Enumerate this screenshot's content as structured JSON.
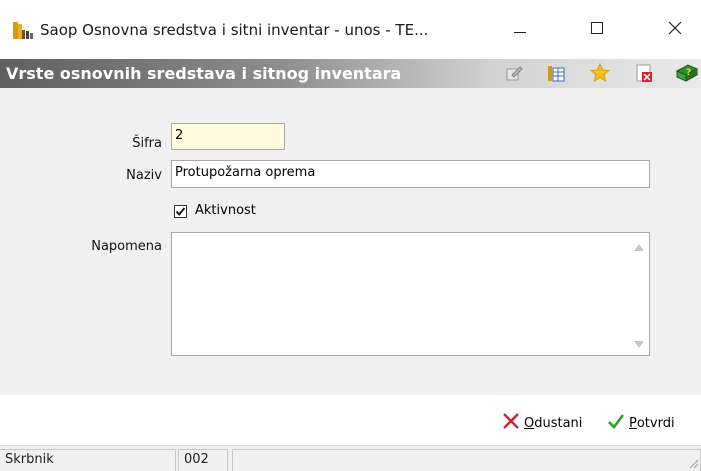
{
  "window": {
    "title": "Saop Osnovna sredstva i sitni inventar - unos - TE...",
    "app_icon": "books-icon",
    "controls": {
      "minimize": "minimize-icon",
      "maximize": "maximize-icon",
      "close": "close-icon"
    }
  },
  "form_header": {
    "title": "Vrste osnovnih sredstava i sitnog inventara",
    "icons": [
      "edit-icon",
      "grid-icon",
      "star-icon",
      "delete-icon",
      "help-book-icon"
    ]
  },
  "form": {
    "sifra": {
      "label": "Šifra",
      "value": "2"
    },
    "naziv": {
      "label": "Naziv",
      "value": "Protupožarna oprema"
    },
    "aktivnost": {
      "label": "Aktivnost",
      "checked": true
    },
    "napomena": {
      "label": "Napomena",
      "value": ""
    }
  },
  "actions": {
    "cancel": {
      "prefix": "",
      "underlined": "O",
      "rest": "dustani",
      "icon": "x-icon"
    },
    "confirm": {
      "prefix": "",
      "underlined": "P",
      "rest": "otvrdi",
      "icon": "checkmark-icon"
    }
  },
  "statusbar": {
    "user": "Skrbnik",
    "code": "002"
  },
  "colors": {
    "header_gradient_start": "#5f5f5f",
    "highlight_field": "#fffbe0",
    "cancel_red": "#d2232a",
    "confirm_green": "#2e9b2e"
  }
}
